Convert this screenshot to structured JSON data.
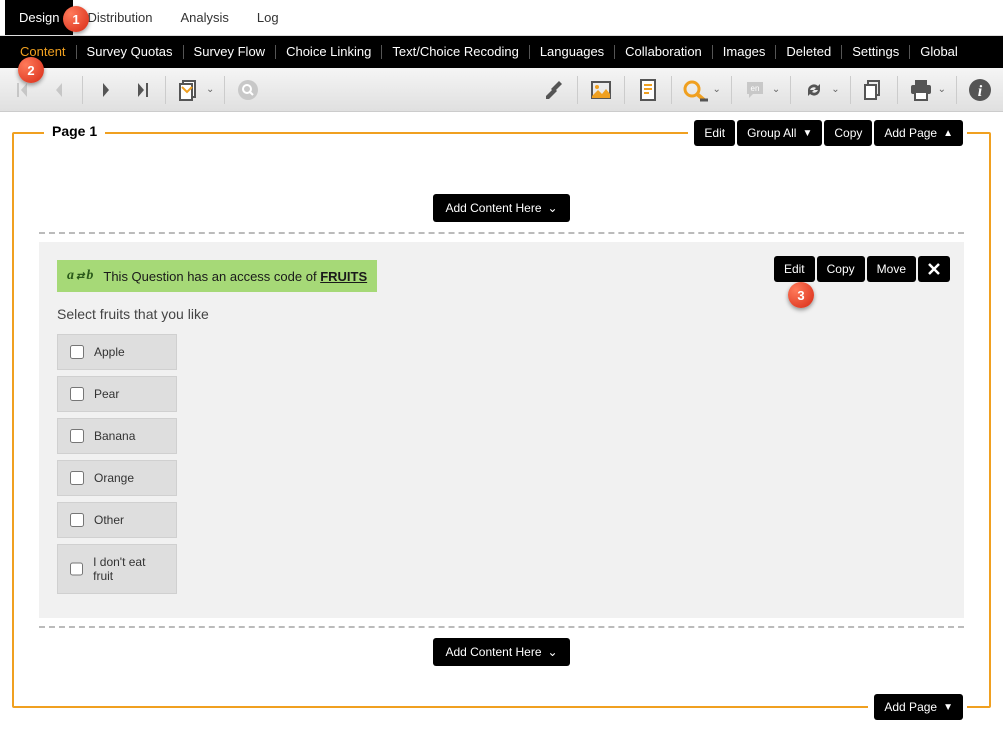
{
  "main_nav": {
    "items": [
      "Design",
      "Distribution",
      "Analysis",
      "Log"
    ],
    "active_index": 0
  },
  "sub_nav": {
    "items": [
      "Content",
      "Survey Quotas",
      "Survey Flow",
      "Choice Linking",
      "Text/Choice Recoding",
      "Languages",
      "Collaboration",
      "Images",
      "Deleted",
      "Settings",
      "Global"
    ],
    "active_index": 0
  },
  "page": {
    "label": "Page 1",
    "actions": {
      "edit": "Edit",
      "group_all": "Group All",
      "copy": "Copy",
      "add_page": "Add Page"
    },
    "add_content_label": "Add Content Here",
    "bottom_add_page": "Add Page"
  },
  "question": {
    "access_code_banner_prefix": "This Question has an access code of ",
    "access_code": "FRUITS",
    "title": "Select fruits that you like",
    "choices": [
      "Apple",
      "Pear",
      "Banana",
      "Orange",
      "Other",
      "I don't eat fruit"
    ],
    "actions": {
      "edit": "Edit",
      "copy": "Copy",
      "move": "Move"
    }
  },
  "annotations": {
    "b1": "1",
    "b2": "2",
    "b3": "3"
  }
}
